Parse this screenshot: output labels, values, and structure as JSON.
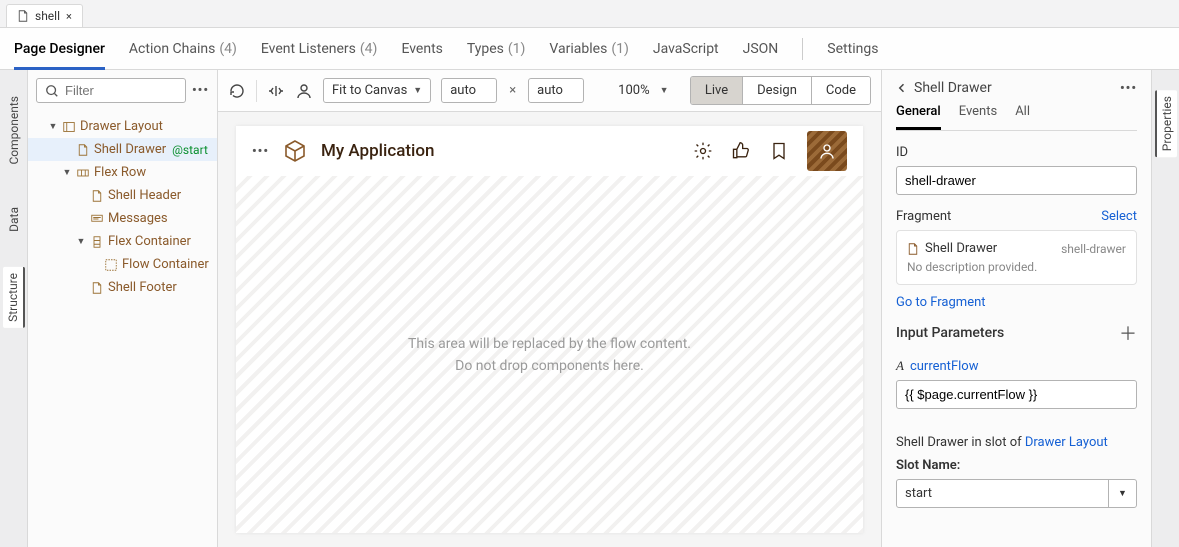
{
  "fileTab": {
    "name": "shell"
  },
  "pageTabs": {
    "pageDesigner": "Page Designer",
    "actionChains": "Action Chains",
    "actionChainsCount": "(4)",
    "eventListeners": "Event Listeners",
    "eventListenersCount": "(4)",
    "events": "Events",
    "types": "Types",
    "typesCount": "(1)",
    "variables": "Variables",
    "variablesCount": "(1)",
    "javascript": "JavaScript",
    "json": "JSON",
    "settings": "Settings"
  },
  "leftRail": {
    "components": "Components",
    "data": "Data",
    "structure": "Structure"
  },
  "filter": {
    "placeholder": "Filter"
  },
  "tree": [
    {
      "label": "Drawer Layout",
      "indent": 1,
      "caret": true,
      "icon": "layout"
    },
    {
      "label": "Shell Drawer",
      "indent": 2,
      "caret": false,
      "icon": "page",
      "selected": true,
      "badge": "@start"
    },
    {
      "label": "Flex Row",
      "indent": 2,
      "caret": true,
      "icon": "flexrow"
    },
    {
      "label": "Shell Header",
      "indent": 3,
      "caret": false,
      "icon": "page"
    },
    {
      "label": "Messages",
      "indent": 3,
      "caret": false,
      "icon": "msg"
    },
    {
      "label": "Flex Container",
      "indent": 3,
      "caret": true,
      "icon": "flexcol"
    },
    {
      "label": "Flow Container",
      "indent": 4,
      "caret": false,
      "icon": "flow"
    },
    {
      "label": "Shell Footer",
      "indent": 3,
      "caret": false,
      "icon": "page"
    }
  ],
  "toolbar": {
    "fit": "Fit to Canvas",
    "width": "auto",
    "height": "auto",
    "zoom": "100%",
    "mode": {
      "live": "Live",
      "design": "Design",
      "code": "Code"
    }
  },
  "app": {
    "title": "My Application",
    "body1": "This area will be replaced by the flow content.",
    "body2": "Do not drop components here."
  },
  "rightPanel": {
    "title": "Shell Drawer",
    "tabs": {
      "general": "General",
      "events": "Events",
      "all": "All"
    },
    "idLabel": "ID",
    "idValue": "shell-drawer",
    "fragmentLabel": "Fragment",
    "selectLabel": "Select",
    "fragmentName": "Shell Drawer",
    "fragmentId": "shell-drawer",
    "fragmentDesc": "No description provided.",
    "goToFragment": "Go to Fragment",
    "inputParams": "Input Parameters",
    "paramName": "currentFlow",
    "paramValue": "{{ $page.currentFlow }}",
    "slotText1": "Shell Drawer in slot of ",
    "slotLink": "Drawer Layout",
    "slotNameLabel": "Slot Name:",
    "slotNameValue": "start"
  },
  "rightRail": {
    "properties": "Properties"
  }
}
